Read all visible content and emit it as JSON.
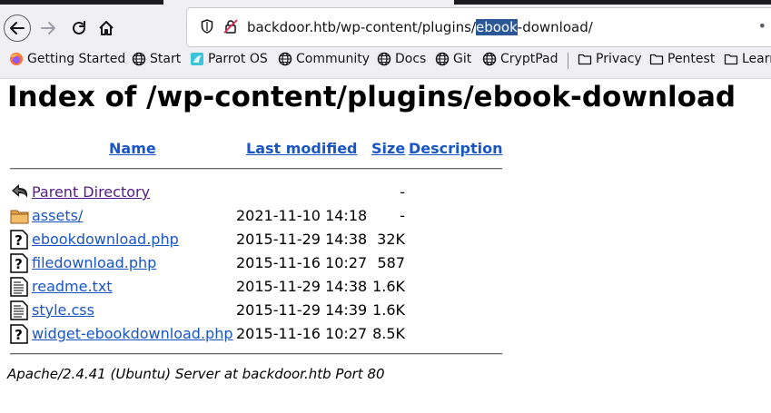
{
  "browser": {
    "url_prefix": "backdoor.htb/wp-content/plugins/",
    "url_selected": "ebook",
    "url_suffix": "-download/",
    "url_more": "•"
  },
  "bookmarks": [
    {
      "label": "Getting Started",
      "icon": "firefox-icon"
    },
    {
      "label": "Start",
      "icon": "globe-icon"
    },
    {
      "label": "Parrot OS",
      "icon": "parrot-icon"
    },
    {
      "label": "Community",
      "icon": "globe-icon"
    },
    {
      "label": "Docs",
      "icon": "globe-icon"
    },
    {
      "label": "Git",
      "icon": "globe-icon"
    },
    {
      "label": "CryptPad",
      "icon": "globe-icon"
    },
    {
      "label": "Privacy",
      "icon": "folder-icon"
    },
    {
      "label": "Pentest",
      "icon": "folder-icon"
    },
    {
      "label": "Learn",
      "icon": "folder-icon"
    }
  ],
  "page": {
    "title": "Index of /wp-content/plugins/ebook-download",
    "columns": {
      "name": "Name",
      "last_modified": "Last modified",
      "size": "Size",
      "description": "Description"
    },
    "entries": [
      {
        "name": "Parent Directory",
        "date": "",
        "size": "-",
        "icon": "back-arrow-icon"
      },
      {
        "name": "assets/",
        "date": "2021-11-10 14:18",
        "size": "-",
        "icon": "folder-icon"
      },
      {
        "name": "ebookdownload.php",
        "date": "2015-11-29 14:38",
        "size": "32K",
        "icon": "unknown-file-icon"
      },
      {
        "name": "filedownload.php",
        "date": "2015-11-16 10:27",
        "size": "587",
        "icon": "unknown-file-icon"
      },
      {
        "name": "readme.txt",
        "date": "2015-11-29 14:38",
        "size": "1.6K",
        "icon": "text-file-icon"
      },
      {
        "name": "style.css",
        "date": "2015-11-29 14:39",
        "size": "1.6K",
        "icon": "text-file-icon"
      },
      {
        "name": "widget-ebookdownload.php",
        "date": "2015-11-16 10:27",
        "size": "8.5K",
        "icon": "unknown-file-icon"
      }
    ],
    "footer": "Apache/2.4.41 (Ubuntu) Server at backdoor.htb Port 80"
  },
  "colors": {
    "link": "#1a55c4",
    "visited": "#551a8b",
    "selection": "#2b5797"
  }
}
